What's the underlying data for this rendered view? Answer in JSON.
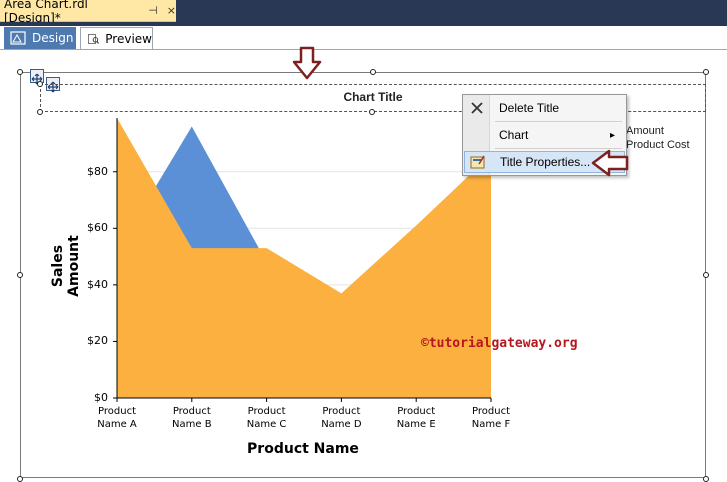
{
  "document_tab": {
    "title": "Area Chart.rdl [Design]*",
    "pin_glyph": "⊣",
    "close_glyph": "×"
  },
  "view_tabs": [
    {
      "label": "Design",
      "icon": "design-icon",
      "active": true
    },
    {
      "label": "Preview",
      "icon": "preview-icon",
      "active": false
    }
  ],
  "chart": {
    "title": "Chart Title",
    "watermark": "©tutorialgateway.org",
    "legend_partial": [
      "Amount",
      "Product Cost"
    ]
  },
  "context_menu": {
    "items": [
      {
        "label": "Delete Title",
        "icon": "close-icon",
        "submenu": false
      },
      {
        "label": "Chart",
        "icon": "",
        "submenu": true,
        "arrow": "▸"
      },
      {
        "label": "Title Properties...",
        "icon": "title-properties-icon",
        "submenu": false,
        "highlighted": true
      }
    ]
  },
  "colors": {
    "sales_area": "#fbb040",
    "cost_area": "#5b90d6",
    "annotation_arrow": "#7d2020",
    "tab_active": "#4f7ab0",
    "doc_tab": "#ffe8a6"
  },
  "chart_data": {
    "type": "area",
    "categories": [
      "Product Name A",
      "Product Name B",
      "Product Name C",
      "Product Name D",
      "Product Name E",
      "Product Name F"
    ],
    "x_tick_lines": [
      [
        "Product",
        "Name A"
      ],
      [
        "Product",
        "Name B"
      ],
      [
        "Product",
        "Name C"
      ],
      [
        "Product",
        "Name D"
      ],
      [
        "Product",
        "Name E"
      ],
      [
        "Product",
        "Name F"
      ]
    ],
    "series": [
      {
        "name": "Product Cost",
        "color": "#5b90d6",
        "values": [
          52,
          96,
          48,
          34,
          58,
          84
        ]
      },
      {
        "name": "Sales Amount",
        "color": "#fbb040",
        "values": [
          99,
          53,
          53,
          37,
          61,
          86
        ]
      }
    ],
    "xlabel": "Product Name",
    "ylabel": "Sales Amount",
    "yticks": [
      "$0",
      "$20",
      "$40",
      "$60",
      "$80"
    ],
    "ytick_values": [
      0,
      20,
      40,
      60,
      80
    ],
    "ylim": [
      0,
      99
    ],
    "grid": true
  }
}
